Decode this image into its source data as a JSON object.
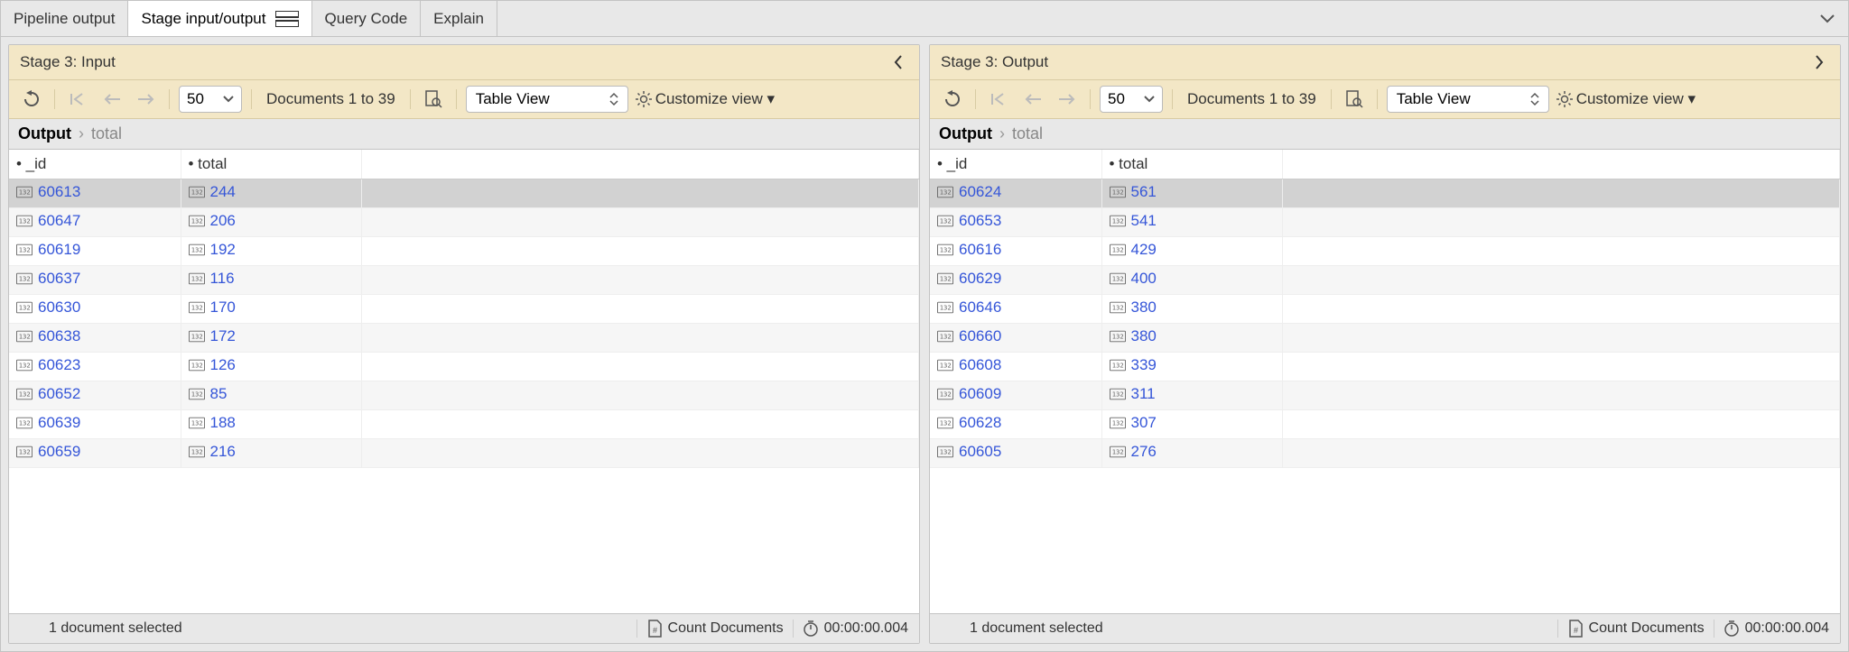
{
  "tabs": {
    "pipeline_output": "Pipeline output",
    "stage_io": "Stage input/output",
    "query_code": "Query Code",
    "explain": "Explain"
  },
  "panels": {
    "input": {
      "title": "Stage 3: Input",
      "toolbar": {
        "page_size": "50",
        "doc_range": "Documents 1 to 39",
        "view": "Table View",
        "customize": "Customize view ▾"
      },
      "breadcrumb": {
        "root": "Output",
        "leaf": "total"
      },
      "columns": {
        "id": "• _id",
        "total": "• total"
      },
      "rows": [
        {
          "id": "60613",
          "total": "244"
        },
        {
          "id": "60647",
          "total": "206"
        },
        {
          "id": "60619",
          "total": "192"
        },
        {
          "id": "60637",
          "total": "116"
        },
        {
          "id": "60630",
          "total": "170"
        },
        {
          "id": "60638",
          "total": "172"
        },
        {
          "id": "60623",
          "total": "126"
        },
        {
          "id": "60652",
          "total": "85"
        },
        {
          "id": "60639",
          "total": "188"
        },
        {
          "id": "60659",
          "total": "216"
        }
      ],
      "footer": {
        "selection": "1 document selected",
        "count": "Count Documents",
        "time": "00:00:00.004"
      }
    },
    "output": {
      "title": "Stage 3: Output",
      "toolbar": {
        "page_size": "50",
        "doc_range": "Documents 1 to 39",
        "view": "Table View",
        "customize": "Customize view ▾"
      },
      "breadcrumb": {
        "root": "Output",
        "leaf": "total"
      },
      "columns": {
        "id": "• _id",
        "total": "• total"
      },
      "rows": [
        {
          "id": "60624",
          "total": "561"
        },
        {
          "id": "60653",
          "total": "541"
        },
        {
          "id": "60616",
          "total": "429"
        },
        {
          "id": "60629",
          "total": "400"
        },
        {
          "id": "60646",
          "total": "380"
        },
        {
          "id": "60660",
          "total": "380"
        },
        {
          "id": "60608",
          "total": "339"
        },
        {
          "id": "60609",
          "total": "311"
        },
        {
          "id": "60628",
          "total": "307"
        },
        {
          "id": "60605",
          "total": "276"
        }
      ],
      "footer": {
        "selection": "1 document selected",
        "count": "Count Documents",
        "time": "00:00:00.004"
      }
    }
  }
}
